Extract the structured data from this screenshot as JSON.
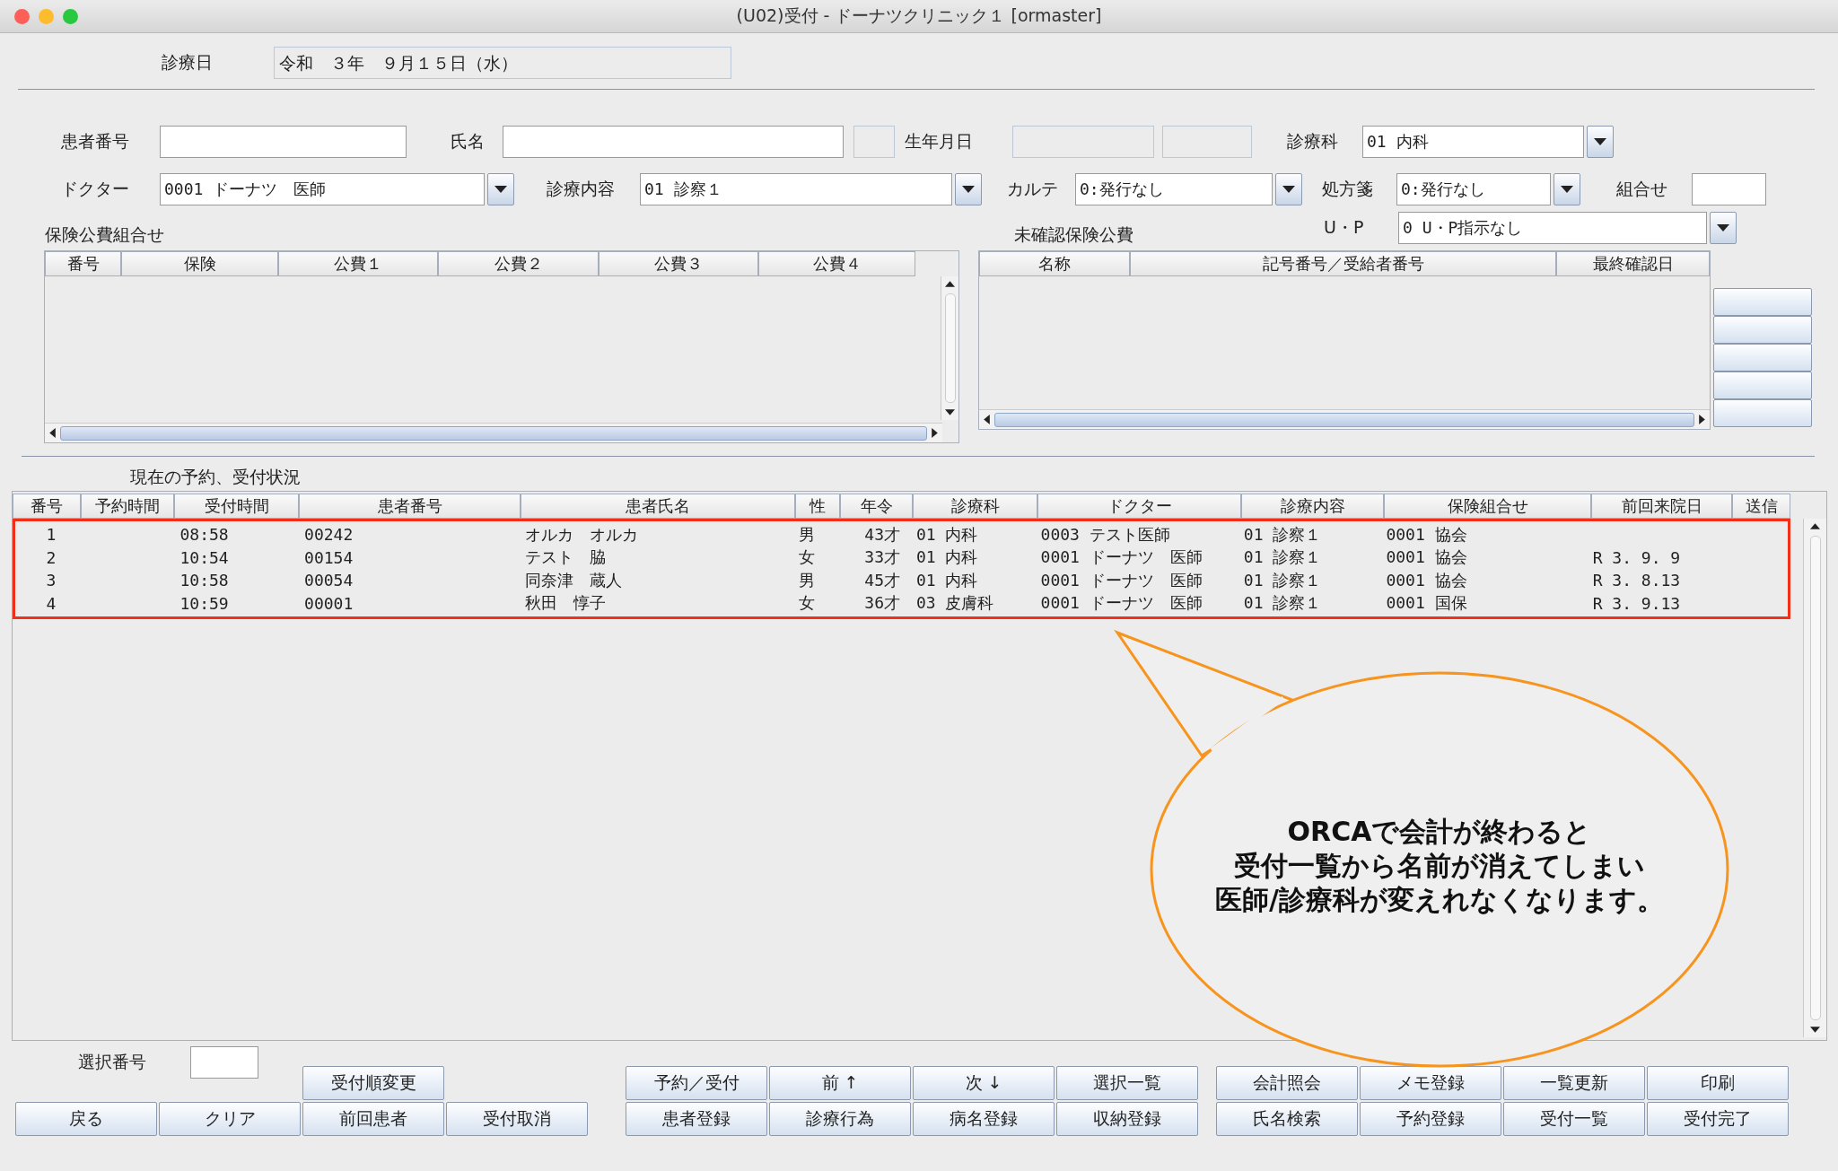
{
  "window": {
    "title": "(U02)受付 - ドーナツクリニック１ [ormaster]"
  },
  "date": {
    "label": "診療日",
    "value": "令和　３年　９月１５日（水）"
  },
  "patient_number": {
    "label": "患者番号"
  },
  "name": {
    "label": "氏名"
  },
  "birth_date": {
    "label": "生年月日"
  },
  "department": {
    "label": "診療科",
    "value": "01 内科"
  },
  "doctor": {
    "label": "ドクター",
    "value": "0001 ドーナツ　医師"
  },
  "consultation": {
    "label": "診療内容",
    "value": "01 診察１"
  },
  "chart": {
    "label": "カルテ",
    "value": "0:発行なし"
  },
  "prescription": {
    "label": "処方箋",
    "value": "0:発行なし"
  },
  "combination": {
    "label": "組合せ"
  },
  "up": {
    "label": "U・P",
    "value": "0 U・P指示なし"
  },
  "insurance_table": {
    "title": "保険公費組合せ",
    "columns": [
      "番号",
      "保険",
      "公費１",
      "公費２",
      "公費３",
      "公費４"
    ]
  },
  "unconfirmed_table": {
    "title": "未確認保険公費",
    "columns": [
      "名称",
      "記号番号／受給者番号",
      "最終確認日"
    ]
  },
  "reception_table": {
    "title": "現在の予約、受付状況",
    "columns": [
      "番号",
      "予約時間",
      "受付時間",
      "患者番号",
      "患者氏名",
      "性",
      "年令",
      "診療科",
      "ドクター",
      "診療内容",
      "保険組合せ",
      "前回来院日",
      "送信"
    ],
    "rows": [
      [
        "1",
        "",
        "08:58",
        "00242",
        "オルカ　オルカ",
        "男",
        "43才",
        "01 内科",
        "0003 テスト医師",
        "01 診察１",
        "0001 協会",
        "",
        ""
      ],
      [
        "2",
        "",
        "10:54",
        "00154",
        "テスト　脇",
        "女",
        "33才",
        "01 内科",
        "0001 ドーナツ　医師",
        "01 診察１",
        "0001 協会",
        "R 3. 9. 9",
        ""
      ],
      [
        "3",
        "",
        "10:58",
        "00054",
        "同奈津　蔵人",
        "男",
        "45才",
        "01 内科",
        "0001 ドーナツ　医師",
        "01 診察１",
        "0001 協会",
        "R 3. 8.13",
        ""
      ],
      [
        "4",
        "",
        "10:59",
        "00001",
        "秋田　惇子",
        "女",
        "36才",
        "03 皮膚科",
        "0001 ドーナツ　医師",
        "01 診察１",
        "0001 国保",
        "R 3. 9.13",
        ""
      ]
    ]
  },
  "callout": {
    "lines": [
      "ORCAで会計が終わると",
      "受付一覧から名前が消えてしまい",
      "医師/診療科が変えれなくなります。"
    ]
  },
  "selection": {
    "label": "選択番号"
  },
  "buttons": {
    "left_top": [
      "受付順変更"
    ],
    "left_bottom": [
      "戻る",
      "クリア",
      "前回患者",
      "受付取消"
    ],
    "middle_top": [
      "予約／受付",
      "前 ↑",
      "次 ↓",
      "選択一覧"
    ],
    "middle_bottom": [
      "患者登録",
      "診療行為",
      "病名登録",
      "収納登録"
    ],
    "right_top": [
      "会計照会",
      "メモ登録",
      "一覧更新",
      "印刷"
    ],
    "right_bottom": [
      "氏名検索",
      "予約登録",
      "受付一覧",
      "受付完了"
    ]
  }
}
